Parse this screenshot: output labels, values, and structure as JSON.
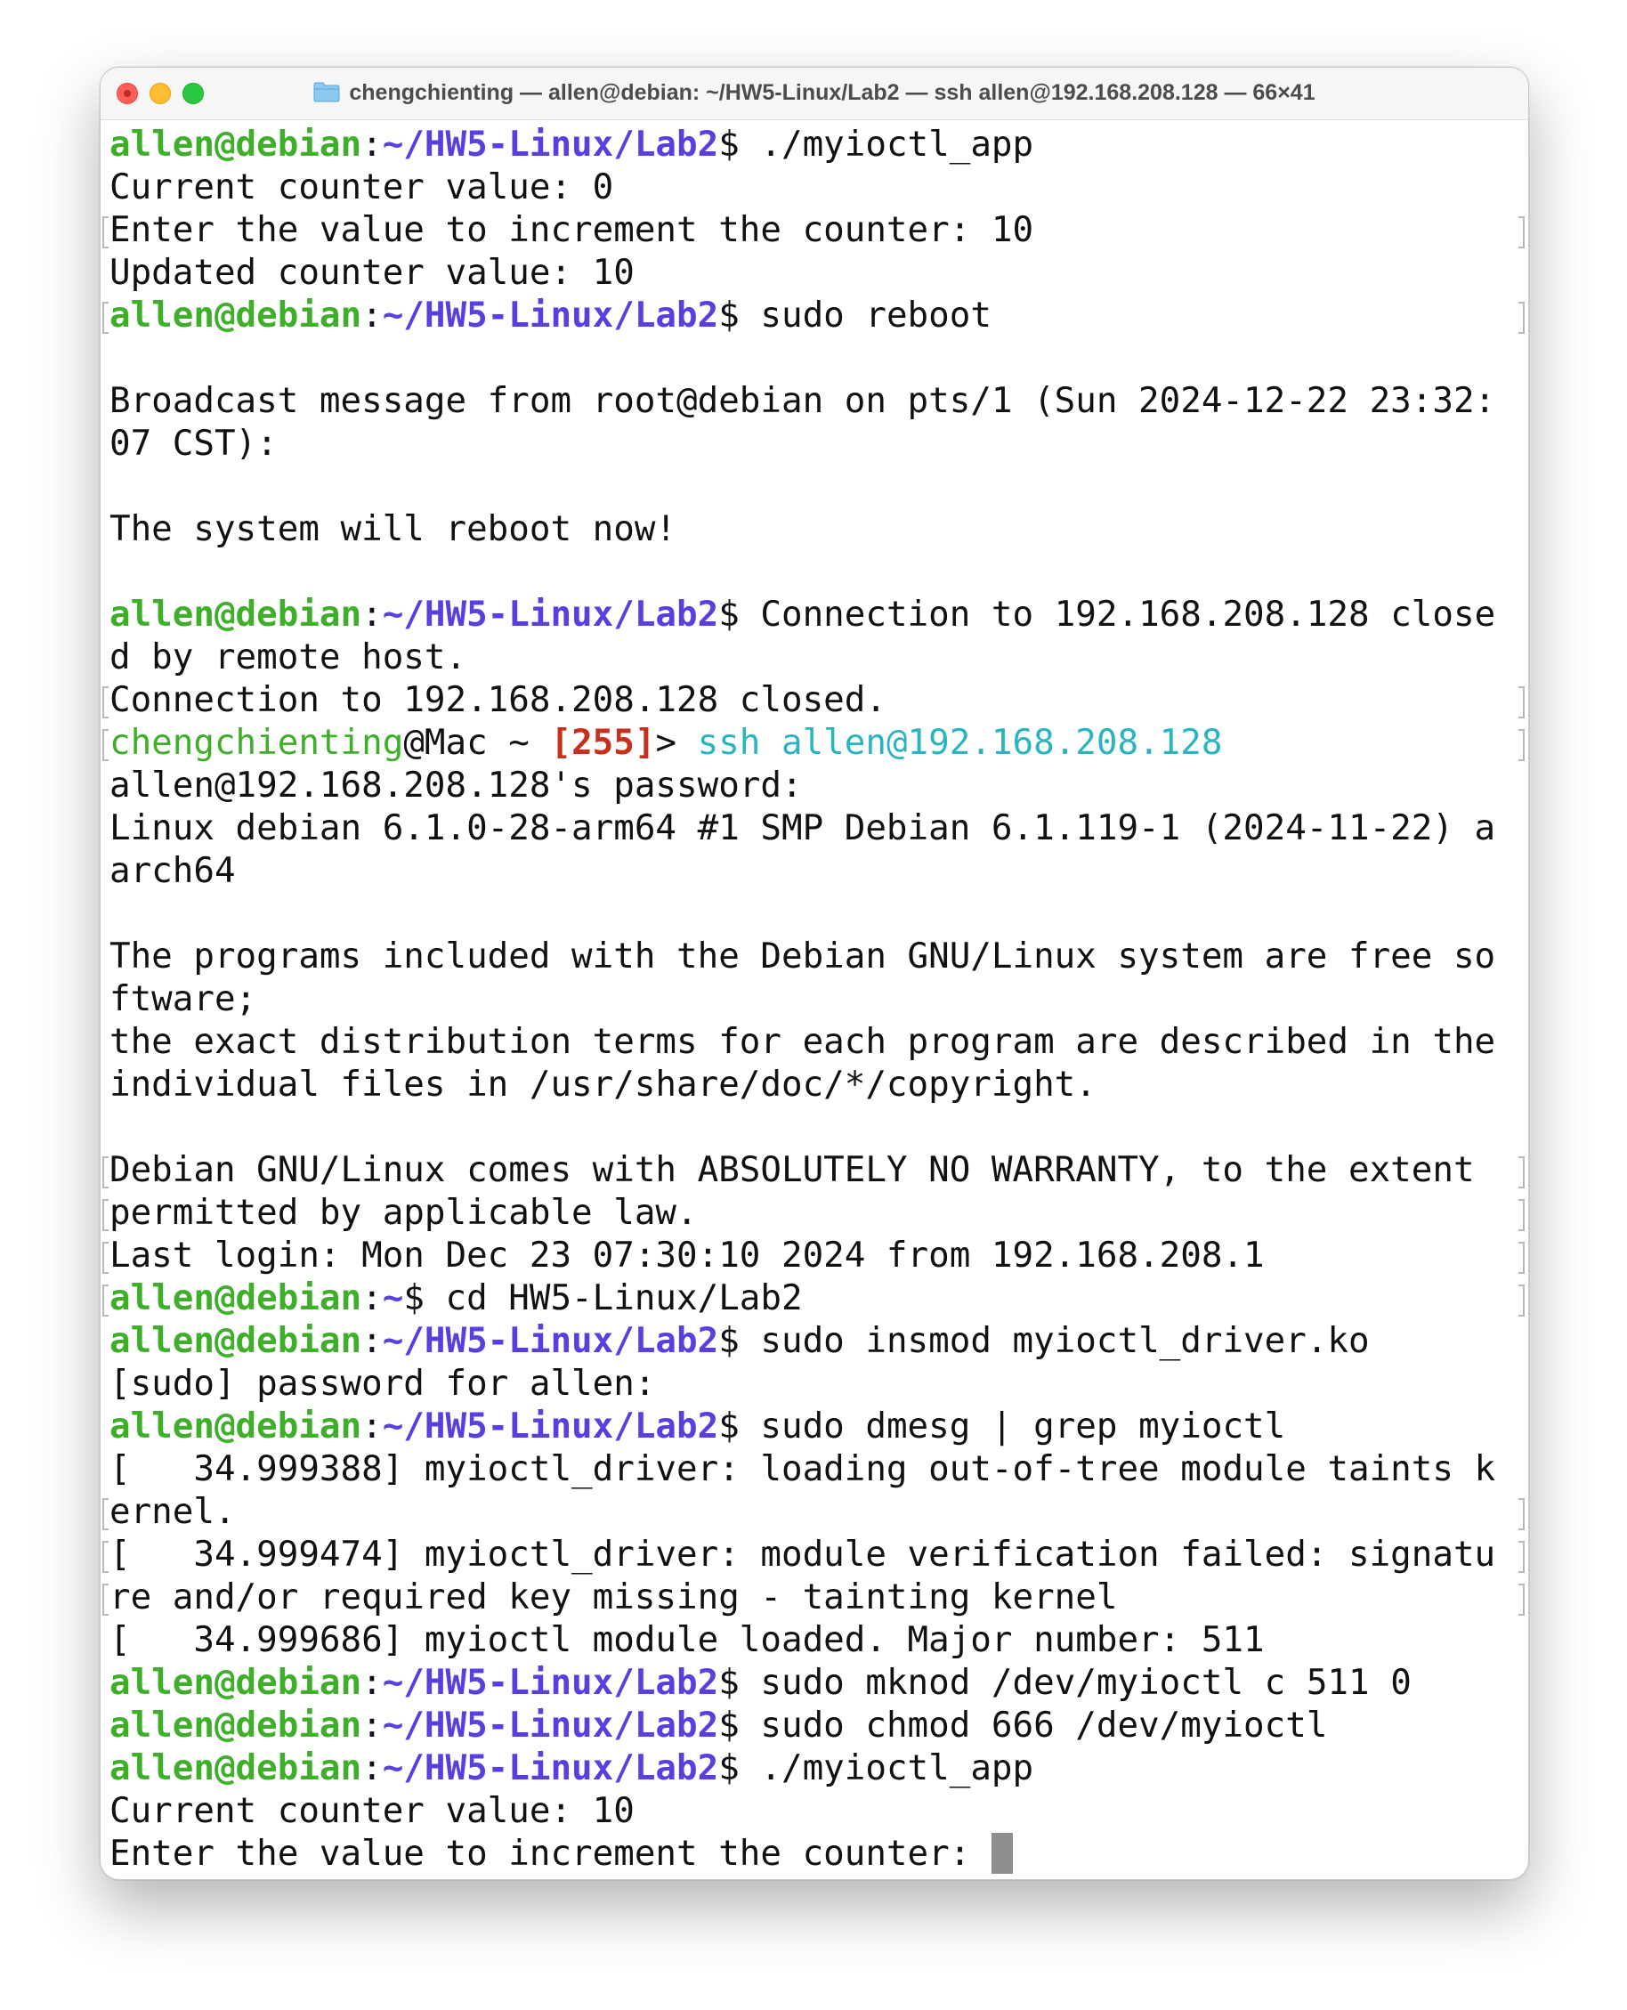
{
  "window": {
    "title": "chengchienting — allen@debian: ~/HW5-Linux/Lab2 — ssh allen@192.168.208.128 — 66×41",
    "title_icon": "folder-icon"
  },
  "prompt": {
    "user_host": "allen@debian",
    "lab_path": "~/HW5-Linux/Lab2",
    "home_path": "~",
    "suffix": "$ ",
    "colon": ":"
  },
  "lines": [
    {
      "kind": "prompt",
      "cmd": "./myioctl_app"
    },
    {
      "kind": "text",
      "text": "Current counter value: 0"
    },
    {
      "kind": "text",
      "text": "Enter the value to increment the counter: 10",
      "marked": true
    },
    {
      "kind": "text",
      "text": "Updated counter value: 10"
    },
    {
      "kind": "prompt",
      "cmd": "sudo reboot",
      "marked": true
    },
    {
      "kind": "text",
      "text": ""
    },
    {
      "kind": "text",
      "text": "Broadcast message from root@debian on pts/1 (Sun 2024-12-22 23:32:"
    },
    {
      "kind": "text",
      "text": "07 CST):"
    },
    {
      "kind": "text",
      "text": ""
    },
    {
      "kind": "text",
      "text": "The system will reboot now!"
    },
    {
      "kind": "text",
      "text": ""
    },
    {
      "kind": "prompt",
      "cmd": "Connection to 192.168.208.128 close"
    },
    {
      "kind": "text",
      "text": "d by remote host."
    },
    {
      "kind": "text",
      "text": "Connection to 192.168.208.128 closed.",
      "marked": true
    },
    {
      "kind": "mac",
      "user": "chengchienting",
      "host": "@Mac ~ ",
      "status_open": "[",
      "status": "255",
      "status_close": "]",
      "arrow": "> ",
      "cmd": "ssh",
      "space": " ",
      "arg": "allen@192.168.208.128",
      "marked": true
    },
    {
      "kind": "text",
      "text": "allen@192.168.208.128's password:"
    },
    {
      "kind": "text",
      "text": "Linux debian 6.1.0-28-arm64 #1 SMP Debian 6.1.119-1 (2024-11-22) a"
    },
    {
      "kind": "text",
      "text": "arch64"
    },
    {
      "kind": "text",
      "text": ""
    },
    {
      "kind": "text",
      "text": "The programs included with the Debian GNU/Linux system are free so"
    },
    {
      "kind": "text",
      "text": "ftware;"
    },
    {
      "kind": "text",
      "text": "the exact distribution terms for each program are described in the"
    },
    {
      "kind": "text",
      "text": "individual files in /usr/share/doc/*/copyright."
    },
    {
      "kind": "text",
      "text": ""
    },
    {
      "kind": "text",
      "text": "Debian GNU/Linux comes with ABSOLUTELY NO WARRANTY, to the extent",
      "marked": true
    },
    {
      "kind": "text",
      "text": "permitted by applicable law.",
      "marked": true
    },
    {
      "kind": "text",
      "text": "Last login: Mon Dec 23 07:30:10 2024 from 192.168.208.1",
      "marked": true
    },
    {
      "kind": "prompt_home",
      "cmd": "cd HW5-Linux/Lab2",
      "marked": true
    },
    {
      "kind": "prompt",
      "cmd": "sudo insmod myioctl_driver.ko"
    },
    {
      "kind": "text",
      "text": "[sudo] password for allen:"
    },
    {
      "kind": "prompt",
      "cmd": "sudo dmesg | grep myioctl"
    },
    {
      "kind": "text",
      "text": "[   34.999388] myioctl_driver: loading out-of-tree module taints k"
    },
    {
      "kind": "text",
      "text": "ernel.",
      "marked": true
    },
    {
      "kind": "text",
      "text": "[   34.999474] myioctl_driver: module verification failed: signatu",
      "marked": true
    },
    {
      "kind": "text",
      "text": "re and/or required key missing - tainting kernel",
      "marked": true
    },
    {
      "kind": "text",
      "text": "[   34.999686] myioctl module loaded. Major number: 511"
    },
    {
      "kind": "prompt",
      "cmd": "sudo mknod /dev/myioctl c 511 0"
    },
    {
      "kind": "prompt",
      "cmd": "sudo chmod 666 /dev/myioctl"
    },
    {
      "kind": "prompt",
      "cmd": "./myioctl_app"
    },
    {
      "kind": "text",
      "text": "Current counter value: 10"
    },
    {
      "kind": "input",
      "text": "Enter the value to increment the counter: "
    }
  ],
  "colors": {
    "user": "#3fae2a",
    "path": "#5a3fe0",
    "status": "#c8301e",
    "ssh": "#2ab4c0",
    "text": "#111111"
  }
}
